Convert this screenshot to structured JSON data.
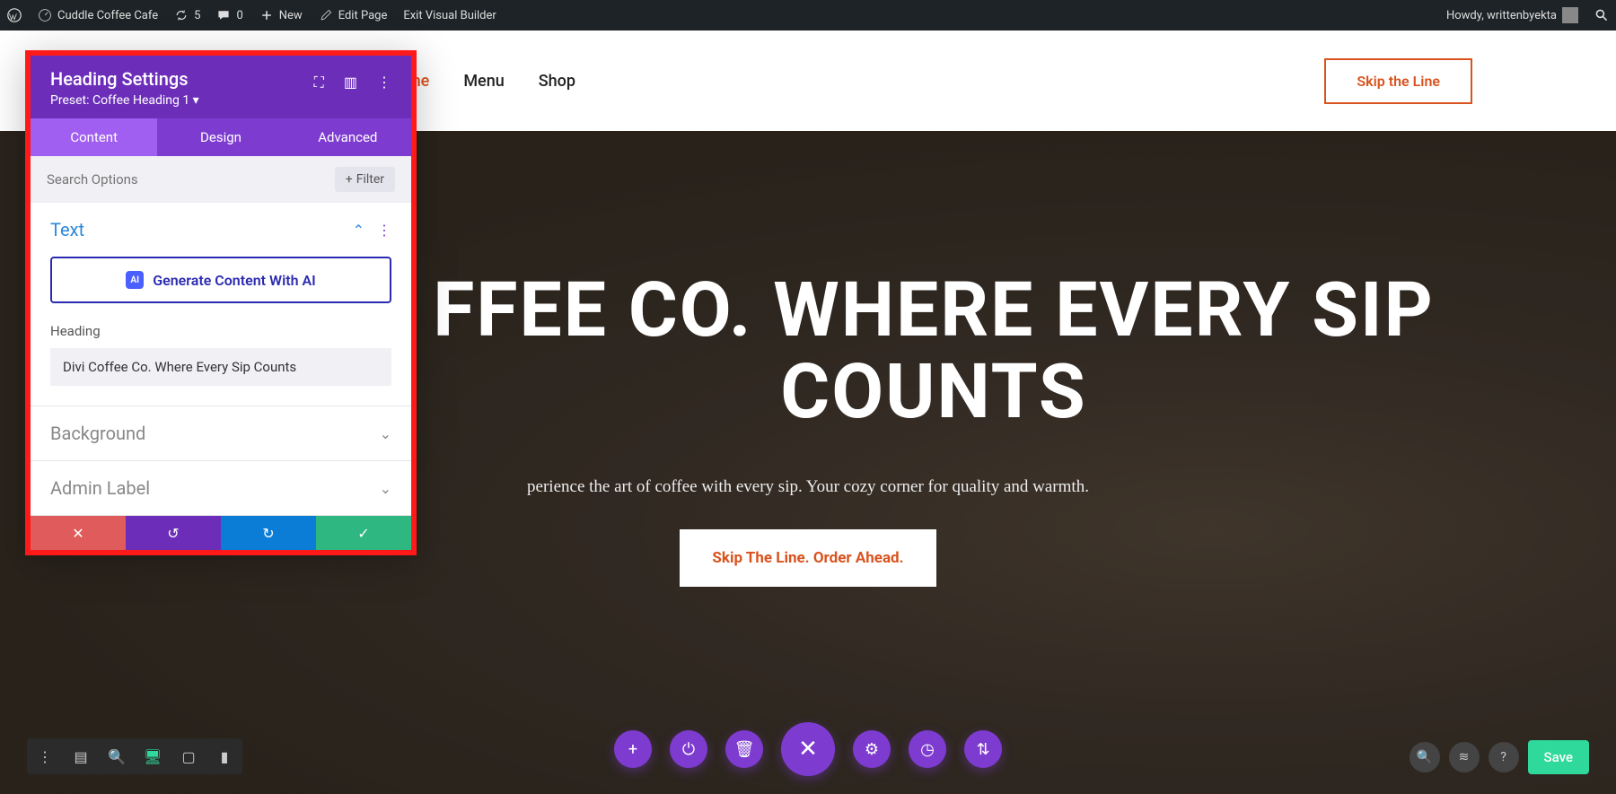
{
  "wpbar": {
    "site": "Cuddle Coffee Cafe",
    "updates": "5",
    "comments": "0",
    "new": "New",
    "edit": "Edit Page",
    "exit": "Exit Visual Builder",
    "howdy": "Howdy, writtenbyekta"
  },
  "nav": {
    "home": "Home",
    "menu": "Menu",
    "shop": "Shop",
    "skip": "Skip the Line"
  },
  "hero": {
    "title": "FFEE CO. WHERE EVERY SIP COUNTS",
    "subtitle": "perience the art of coffee with every sip. Your cozy corner for quality and warmth.",
    "cta": "Skip The Line. Order Ahead."
  },
  "panel": {
    "title": "Heading Settings",
    "preset": "Preset: Coffee Heading 1 ▾",
    "tabs": {
      "content": "Content",
      "design": "Design",
      "advanced": "Advanced"
    },
    "search_placeholder": "Search Options",
    "filter": "Filter",
    "sections": {
      "text": "Text",
      "background": "Background",
      "admin": "Admin Label"
    },
    "ai_btn": "Generate Content With AI",
    "heading_label": "Heading",
    "heading_value": "Divi Coffee Co. Where Every Sip Counts"
  },
  "save_btn": "Save"
}
